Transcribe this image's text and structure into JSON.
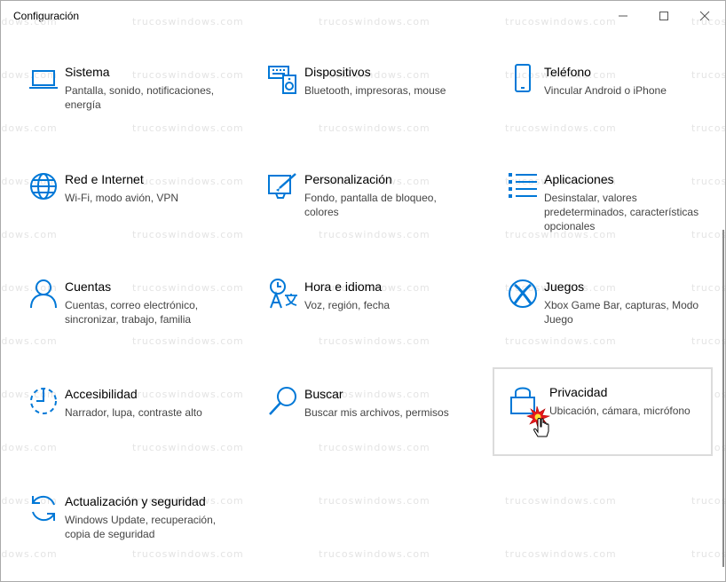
{
  "window": {
    "title": "Configuración",
    "controls": {
      "minimize_icon": "minimize-icon",
      "maximize_icon": "maximize-icon",
      "close_icon": "close-icon"
    }
  },
  "watermark": "trucoswindows.com",
  "accent_color": "#0078d7",
  "tiles": [
    {
      "title": "Sistema",
      "description": "Pantalla, sonido, notificaciones, energía",
      "icon": "laptop-icon"
    },
    {
      "title": "Dispositivos",
      "description": "Bluetooth, impresoras, mouse",
      "icon": "keyboard-speaker-icon"
    },
    {
      "title": "Teléfono",
      "description": "Vincular Android o iPhone",
      "icon": "phone-icon"
    },
    {
      "title": "Red e Internet",
      "description": "Wi-Fi, modo avión, VPN",
      "icon": "globe-icon"
    },
    {
      "title": "Personalización",
      "description": "Fondo, pantalla de bloqueo, colores",
      "icon": "paint-icon"
    },
    {
      "title": "Aplicaciones",
      "description": "Desinstalar, valores predeterminados, características opcionales",
      "icon": "apps-list-icon"
    },
    {
      "title": "Cuentas",
      "description": "Cuentas, correo electrónico, sincronizar, trabajo, familia",
      "icon": "person-icon"
    },
    {
      "title": "Hora e idioma",
      "description": "Voz, región, fecha",
      "icon": "time-language-icon"
    },
    {
      "title": "Juegos",
      "description": "Xbox Game Bar, capturas, Modo Juego",
      "icon": "xbox-icon"
    },
    {
      "title": "Accesibilidad",
      "description": "Narrador, lupa, contraste alto",
      "icon": "accessibility-icon"
    },
    {
      "title": "Buscar",
      "description": "Buscar mis archivos, permisos",
      "icon": "search-icon"
    },
    {
      "title": "Privacidad",
      "description": "Ubicación, cámara, micrófono",
      "icon": "lock-icon"
    },
    {
      "title": "Actualización y seguridad",
      "description": "Windows Update, recuperación, copia de seguridad",
      "icon": "sync-icon"
    }
  ]
}
